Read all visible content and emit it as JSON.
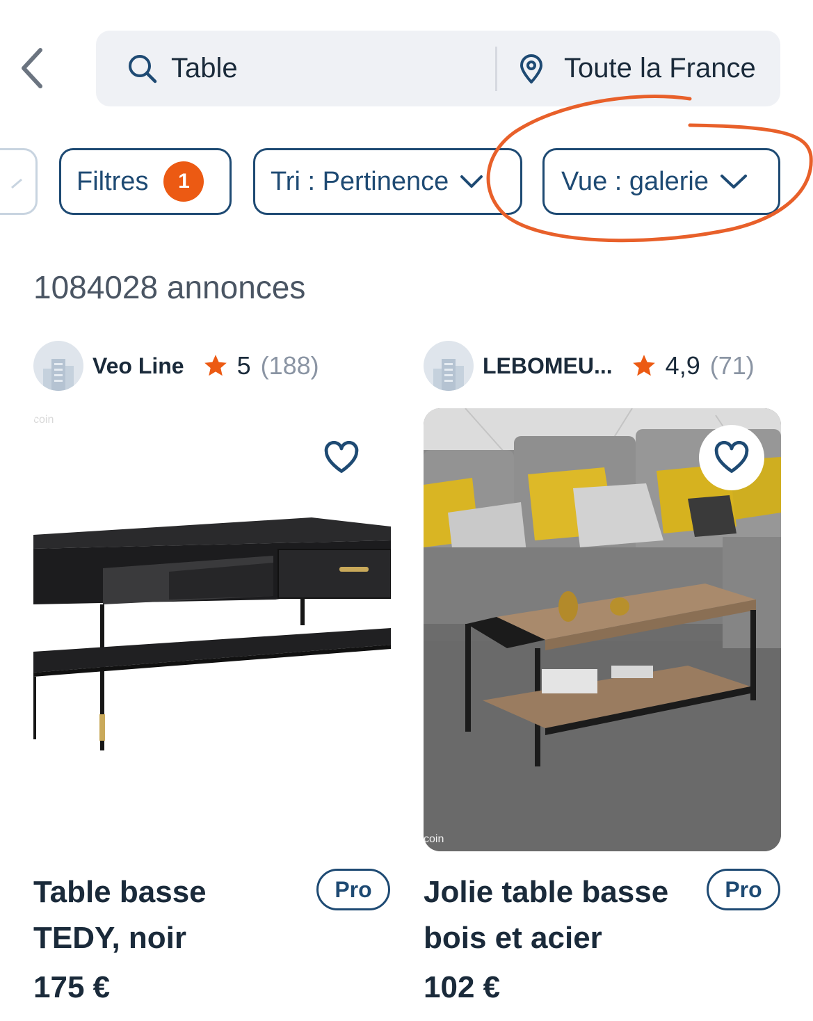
{
  "search": {
    "query": "Table",
    "location": "Toute la France"
  },
  "filters": {
    "filtres_label": "Filtres",
    "filtres_count": "1",
    "sort_label": "Tri : Pertinence",
    "view_label": "Vue : galerie"
  },
  "results": {
    "count_label": "1084028 annonces"
  },
  "listings": [
    {
      "seller": "Veo Line",
      "rating": "5",
      "reviews": "(188)",
      "title": "Table basse TEDY, noir",
      "badge": "Pro",
      "price": "175 €",
      "watermark": "coin"
    },
    {
      "seller": "LEBOMEU...",
      "rating": "4,9",
      "reviews": "(71)",
      "title": "Jolie table basse bois et acier",
      "badge": "Pro",
      "price": "102 €",
      "watermark": "coin"
    }
  ],
  "icons": {
    "back": "chevron-left-icon",
    "search": "search-icon",
    "location": "location-pin-icon",
    "dropdown": "chevron-down-icon",
    "rating": "star-icon",
    "favorite": "heart-icon",
    "avatar": "building-icon"
  },
  "colors": {
    "primary": "#1e4a73",
    "accent": "#ec5a13",
    "search_bg": "#eff1f5",
    "muted_text": "#8a94a3",
    "annotation": "#e8602a"
  }
}
